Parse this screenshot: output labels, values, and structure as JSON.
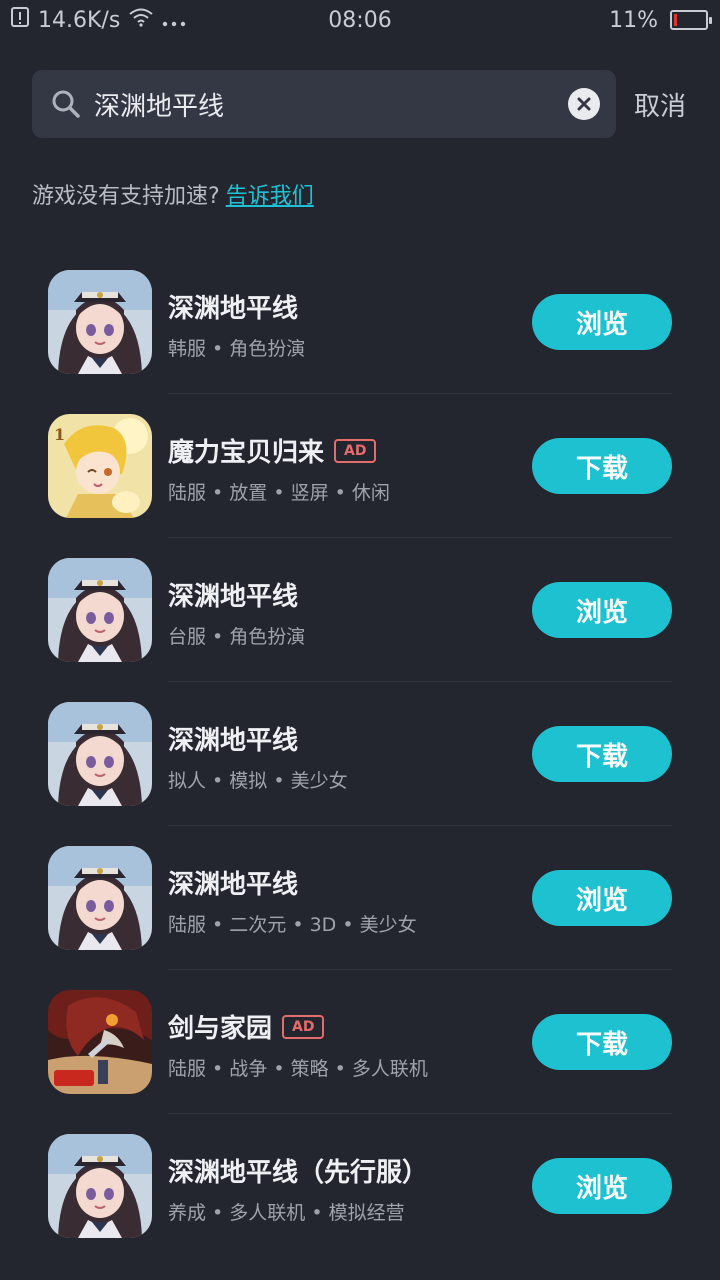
{
  "status_bar": {
    "speed": "14.6K/s",
    "time": "08:06",
    "battery": "11%",
    "battery_level": 0.11,
    "battery_color": "#e0352f",
    "icons": [
      "alert-icon",
      "wifi-icon",
      "more-dots-icon",
      "battery-icon"
    ]
  },
  "search": {
    "value": "深渊地平线",
    "placeholder": "",
    "cancel_label": "取消"
  },
  "hint": {
    "text": "游戏没有支持加速?",
    "link_label": "告诉我们"
  },
  "colors": {
    "accent": "#1ec1d0",
    "ad": "#e46c6c",
    "background": "#23262f"
  },
  "games": [
    {
      "title": "深渊地平线",
      "ad": false,
      "tags": "韩服 • 角色扮演",
      "action": "浏览",
      "icon": "abyss-horizon-icon"
    },
    {
      "title": "魔力宝贝归来",
      "ad": true,
      "ad_label": "AD",
      "tags": "陆服 • 放置 • 竖屏 • 休闲",
      "action": "下载",
      "icon": "crossgate-icon"
    },
    {
      "title": "深渊地平线",
      "ad": false,
      "tags": "台服 • 角色扮演",
      "action": "浏览",
      "icon": "abyss-horizon-icon"
    },
    {
      "title": "深渊地平线",
      "ad": false,
      "tags": "拟人 • 模拟 • 美少女",
      "action": "下载",
      "icon": "abyss-horizon-icon"
    },
    {
      "title": "深渊地平线",
      "ad": false,
      "tags": "陆服 • 二次元 • 3D • 美少女",
      "action": "浏览",
      "icon": "abyss-horizon-icon"
    },
    {
      "title": "剑与家园",
      "ad": true,
      "ad_label": "AD",
      "tags": "陆服 • 战争 • 策略 • 多人联机",
      "action": "下载",
      "icon": "sword-home-icon"
    },
    {
      "title": "深渊地平线（先行服）",
      "ad": false,
      "tags": "养成 • 多人联机 • 模拟经营",
      "action": "浏览",
      "icon": "abyss-horizon-icon"
    }
  ]
}
